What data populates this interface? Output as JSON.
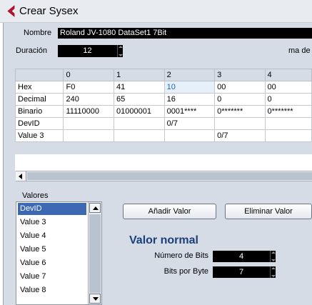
{
  "window": {
    "title": "Crear Sysex",
    "icon": "cubase-logo-icon",
    "accent": "#c8102e"
  },
  "name_field": {
    "label": "Nombre",
    "value": "Roland JV-1080 DataSet1 7Bit"
  },
  "duration_field": {
    "label": "Duración",
    "value": "12"
  },
  "checksum_partial_label": "ma de",
  "table": {
    "columns": [
      "",
      "0",
      "1",
      "2",
      "3",
      "4"
    ],
    "rows": [
      {
        "label": "Hex",
        "cells": [
          "F0",
          "41",
          "10",
          "00",
          "00"
        ]
      },
      {
        "label": "Decimal",
        "cells": [
          "240",
          "65",
          "16",
          "0",
          "0"
        ]
      },
      {
        "label": "Binario",
        "cells": [
          "11110000",
          "01000001",
          "0001****",
          "0*******",
          "0*******"
        ]
      },
      {
        "label": "DevID",
        "cells": [
          "",
          "",
          "0/7",
          "",
          ""
        ]
      },
      {
        "label": "Value 3",
        "cells": [
          "",
          "",
          "",
          "0/7",
          ""
        ]
      }
    ]
  },
  "values_list": {
    "label": "Valores",
    "items": [
      "DevID",
      "Value 3",
      "Value 4",
      "Value 5",
      "Value 6",
      "Value 7",
      "Value 8"
    ],
    "selected": "DevID"
  },
  "buttons": {
    "add": "Añadir Valor",
    "remove": "Eliminar Valor"
  },
  "value_panel": {
    "title": "Valor normal",
    "bits_label": "Número de Bits",
    "bits_value": "4",
    "bits_per_byte_label": "Bits por Byte",
    "bits_per_byte_value": "7"
  },
  "colors": {
    "panel_bg": "#d6dce6",
    "selection": "#3c68b4",
    "heading": "#1a3f7a"
  }
}
